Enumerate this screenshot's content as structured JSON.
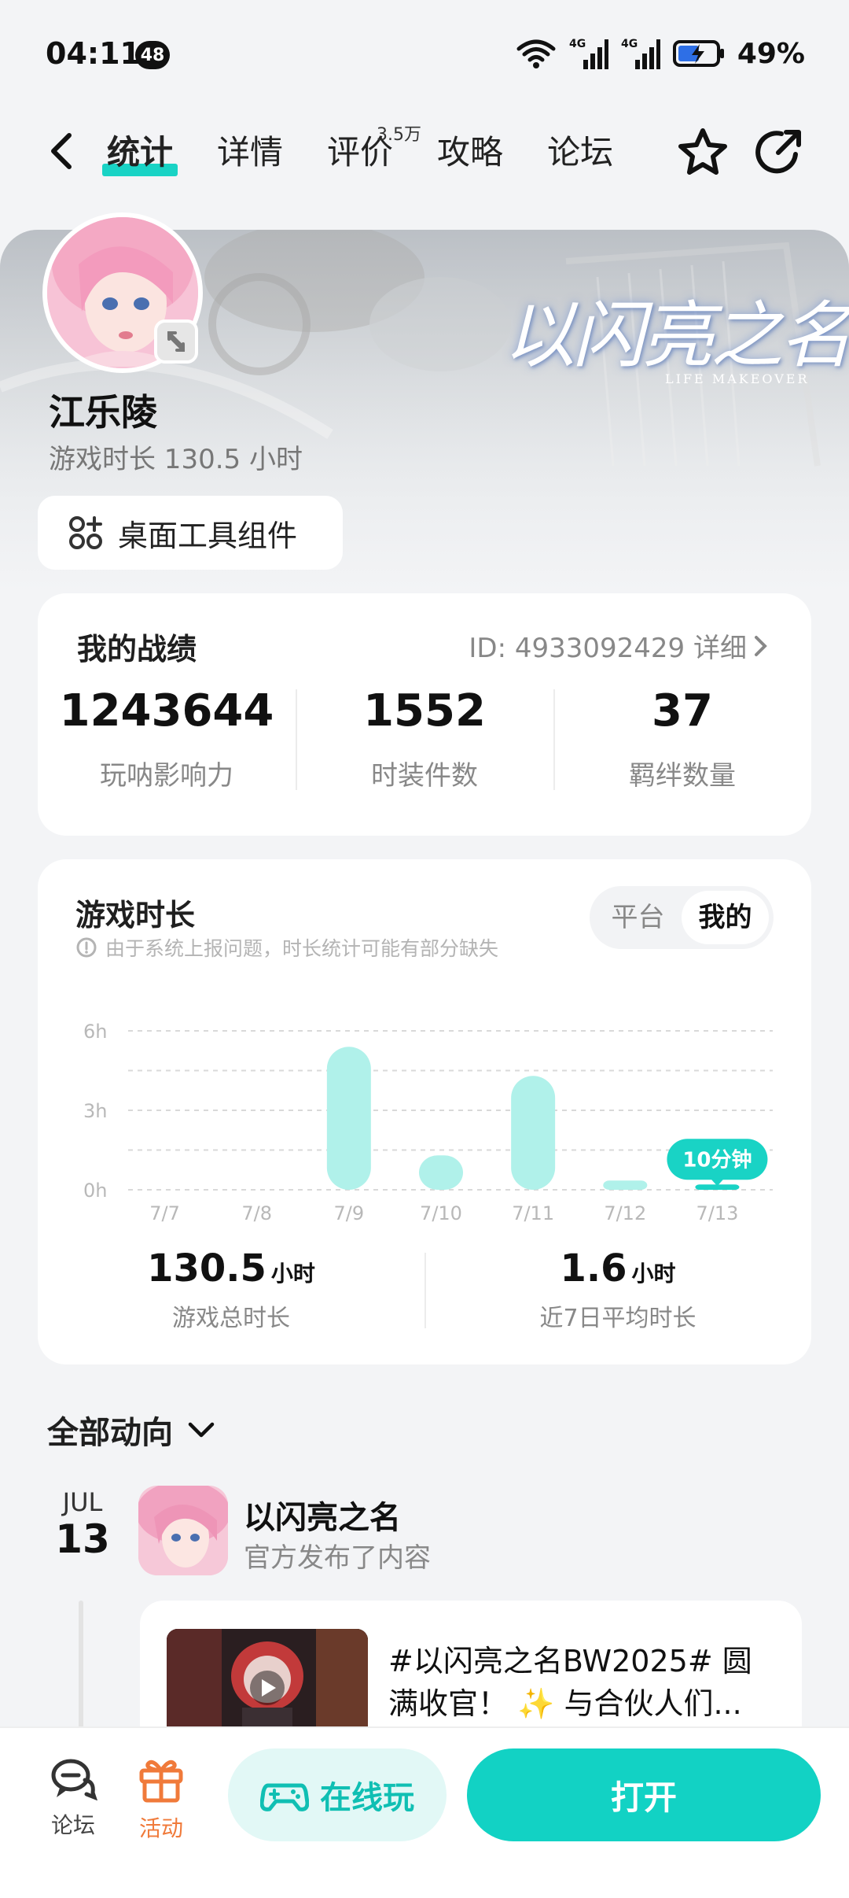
{
  "status_bar": {
    "time": "04:11",
    "notification_count": "48",
    "battery": "49%",
    "network_1": "4G",
    "network_2": "4G"
  },
  "nav": {
    "tabs": [
      {
        "label": "统计",
        "active": true
      },
      {
        "label": "详情",
        "active": false
      },
      {
        "label": "评价",
        "active": false,
        "sup": "3.5万"
      },
      {
        "label": "攻略",
        "active": false
      },
      {
        "label": "论坛",
        "active": false
      }
    ],
    "icons": [
      "back-icon",
      "star-icon",
      "share-icon"
    ]
  },
  "banner": {
    "game_logo": "以闪亮之名",
    "game_logo_sub": "LIFE MAKEOVER"
  },
  "user": {
    "name": "江乐陵",
    "play_time": "游戏时长 130.5 小时",
    "widget_button": "桌面工具组件"
  },
  "record": {
    "title": "我的战绩",
    "id_text": "ID: 4933092429 详细",
    "stats": [
      {
        "value": "1243644",
        "label": "玩呐影响力"
      },
      {
        "value": "1552",
        "label": "时装件数"
      },
      {
        "value": "37",
        "label": "羁绊数量"
      }
    ]
  },
  "game_time": {
    "title": "游戏时长",
    "note": "由于系统上报问题，时长统计可能有部分缺失",
    "segments": [
      {
        "label": "平台",
        "active": false
      },
      {
        "label": "我的",
        "active": true
      }
    ],
    "summary": [
      {
        "value": "130.5",
        "unit": "小时",
        "label": "游戏总时长"
      },
      {
        "value": "1.6",
        "unit": "小时",
        "label": "近7日平均时长"
      }
    ]
  },
  "chart_data": {
    "type": "bar",
    "categories": [
      "7/7",
      "7/8",
      "7/9",
      "7/10",
      "7/11",
      "7/12",
      "7/13"
    ],
    "values": [
      0,
      0,
      5.4,
      1.3,
      4.3,
      0.35,
      0.2
    ],
    "y_unit": "h",
    "yticks": [
      "0h",
      "3h",
      "6h"
    ],
    "ylim": [
      0,
      6
    ],
    "highlight_index": 6,
    "highlight_label": "10分钟",
    "bar_color": "#b0f1ea",
    "highlight_color": "#19d3c5",
    "grid": true
  },
  "feed": {
    "header": "全部动向",
    "month": "JUL",
    "day": "13",
    "game_name": "以闪亮之名",
    "subtitle": "官方发布了内容",
    "post_text": "#以闪亮之名BW2025# 圆满收官！ ✨ 与合伙人们..."
  },
  "bottom_bar": {
    "forum_label": "论坛",
    "event_label": "活动",
    "cloud_play": "在线玩",
    "open": "打开"
  },
  "colors": {
    "accent": "#12d2c4",
    "accent_light": "#e2f8f6",
    "event_orange": "#f07a3a"
  }
}
